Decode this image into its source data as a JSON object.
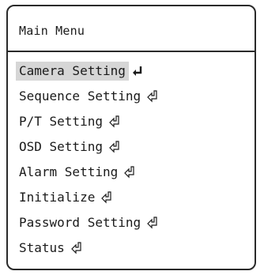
{
  "menu": {
    "title": "Main Menu",
    "items": [
      {
        "label": "Camera Setting",
        "selected": true,
        "icon": "enter-icon"
      },
      {
        "label": "Sequence Setting",
        "selected": false,
        "icon": "enter-icon"
      },
      {
        "label": "P/T Setting",
        "selected": false,
        "icon": "enter-icon"
      },
      {
        "label": "OSD Setting",
        "selected": false,
        "icon": "enter-icon"
      },
      {
        "label": "Alarm Setting",
        "selected": false,
        "icon": "enter-icon"
      },
      {
        "label": "Initialize",
        "selected": false,
        "icon": "enter-icon"
      },
      {
        "label": "Password Setting",
        "selected": false,
        "icon": "enter-icon"
      },
      {
        "label": "Status",
        "selected": false,
        "icon": "enter-icon"
      }
    ]
  }
}
